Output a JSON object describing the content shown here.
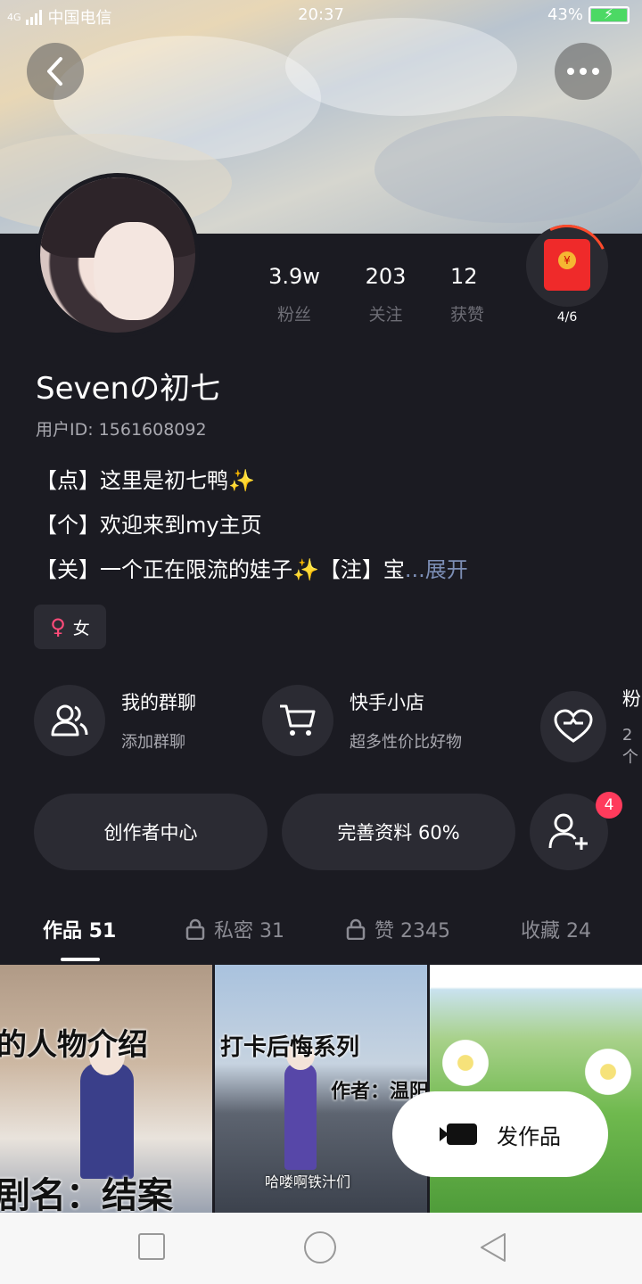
{
  "status_bar": {
    "network": "4G",
    "carrier": "中国电信",
    "time": "20:37",
    "battery": "43%"
  },
  "header": {
    "back_icon": "back-arrow-icon",
    "more_icon": "more-dots-icon"
  },
  "profile": {
    "stats": [
      {
        "value": "3.9w",
        "label": "粉丝"
      },
      {
        "value": "203",
        "label": "关注"
      },
      {
        "value": "12",
        "label": "获赞"
      }
    ],
    "red_packet_progress": "4/6",
    "username": "Sevenの初七",
    "user_id": "用户ID: 1561608092",
    "bio": [
      "【点】这里是初七鸭✨",
      "【个】欢迎来到my主页",
      "【关】一个正在限流的娃子✨【注】宝"
    ],
    "bio_ellipsis": "...",
    "bio_expand": "展开",
    "gender": "女"
  },
  "features": [
    {
      "title": "我的群聊",
      "subtitle": "添加群聊",
      "icon": "group-chat-icon"
    },
    {
      "title": "快手小店",
      "subtitle": "超多性价比好物",
      "icon": "shopping-cart-icon"
    },
    {
      "title": "粉",
      "subtitle": "2个",
      "icon": "heart-icon"
    }
  ],
  "actions": {
    "creator_center": "创作者中心",
    "complete_profile": "完善资料 60%",
    "add_friend_badge": "4"
  },
  "tabs": [
    {
      "label": "作品 51",
      "locked": false,
      "active": true
    },
    {
      "label": "私密 31",
      "locked": true,
      "active": false
    },
    {
      "label": "赞 2345",
      "locked": true,
      "active": false
    },
    {
      "label": "收藏 24",
      "locked": false,
      "active": false
    }
  ],
  "thumbnails": [
    {
      "caption_top": "的人物介绍",
      "caption_bottom": "剧名：结案"
    },
    {
      "caption_top": "打卡后悔系列",
      "caption_author": "作者：温阳",
      "caption_bottom": "哈喽啊铁汁们"
    },
    {
      "caption_top": ""
    }
  ],
  "post_button": "发作品"
}
